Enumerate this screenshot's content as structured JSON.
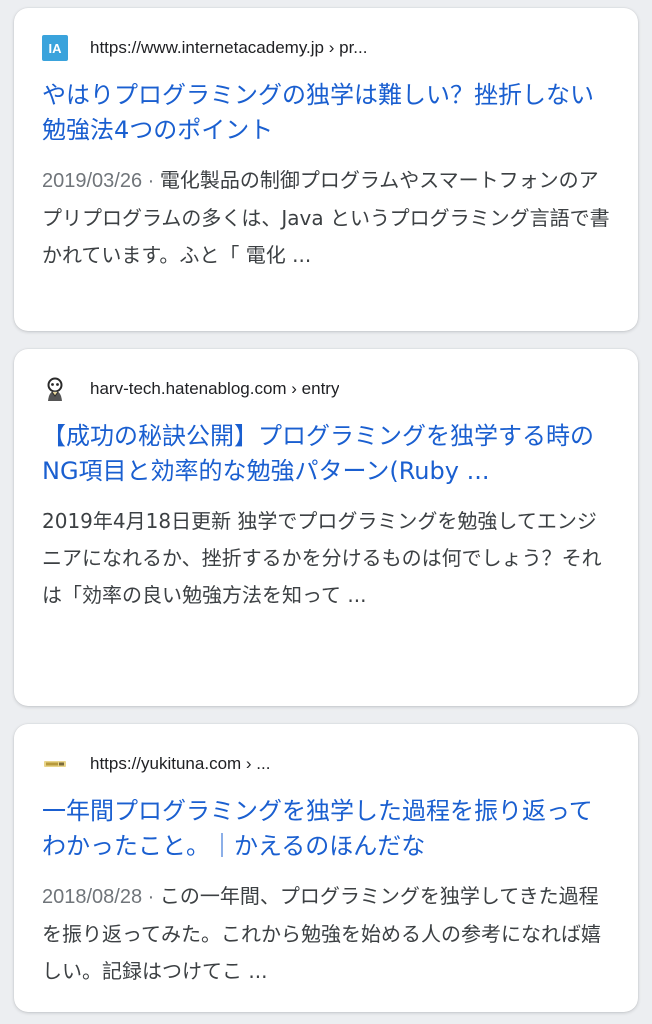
{
  "results": [
    {
      "favicon": "IA",
      "favicon_icon": "internetacademy-logo-icon",
      "url": "https://www.internetacademy.jp › pr...",
      "title": "やはりプログラミングの独学は難しい？挫折しない勉強法4つのポイント",
      "date": "2019/03/26 · ",
      "snippet": "電化製品の制御プログラムやスマートフォンのアプリプログラムの多くは、Java というプログラミング言語で書かれています。ふと「 電化 ..."
    },
    {
      "favicon_icon": "hatena-blog-avatar-icon",
      "url": "harv-tech.hatenablog.com › entry",
      "title": "【成功の秘訣公開】プログラミングを独学する時のNG項目と効率的な勉強パターン(Ruby ...",
      "date": "",
      "snippet": "2019年4月18日更新 独学でプログラミングを勉強してエンジニアになれるか、挫折するかを分けるものは何でしょう？それは「効率の良い勉強方法を知って ..."
    },
    {
      "favicon_icon": "yukituna-site-icon",
      "url": "https://yukituna.com › ...",
      "title": "一年間プログラミングを独学した過程を振り返ってわかったこと。｜かえるのほんだな",
      "date": "2018/08/28 · ",
      "snippet": "この一年間、プログラミングを独学してきた過程を振り返ってみた。これから勉強を始める人の参考になれば嬉しい。記録はつけてこ ..."
    }
  ],
  "colors": {
    "title": "#1a5fd0",
    "snippet": "#3c4043",
    "date": "#70757a",
    "background": "#eceef1",
    "favicon_ia": "#3aa3dc"
  }
}
